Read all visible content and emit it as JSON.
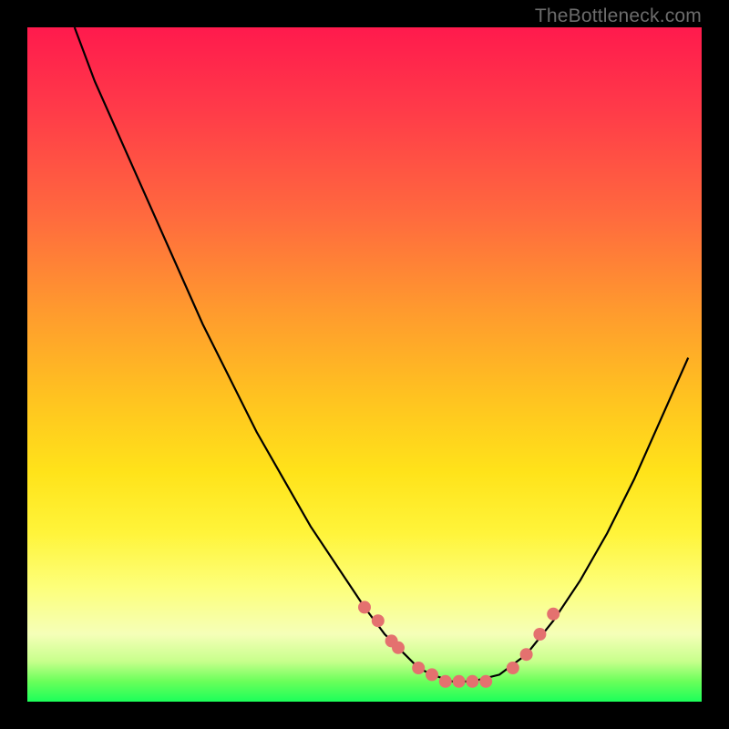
{
  "watermark": "TheBottleneck.com",
  "chart_data": {
    "type": "line",
    "title": "",
    "xlabel": "",
    "ylabel": "",
    "xlim": [
      0,
      100
    ],
    "ylim": [
      0,
      100
    ],
    "grid": false,
    "legend": false,
    "series": [
      {
        "name": "bottleneck-curve",
        "color": "#000000",
        "x": [
          7,
          10,
          14,
          18,
          22,
          26,
          30,
          34,
          38,
          42,
          46,
          50,
          53,
          56,
          58,
          60,
          63,
          66,
          70,
          74,
          78,
          82,
          86,
          90,
          94,
          98
        ],
        "y": [
          100,
          92,
          83,
          74,
          65,
          56,
          48,
          40,
          33,
          26,
          20,
          14,
          10,
          7,
          5,
          4,
          3,
          3,
          4,
          7,
          12,
          18,
          25,
          33,
          42,
          51
        ]
      },
      {
        "name": "highlight-points",
        "color": "#e4716f",
        "type": "scatter",
        "x": [
          50,
          52,
          54,
          55,
          58,
          60,
          62,
          64,
          66,
          68,
          72,
          74,
          76,
          78
        ],
        "y": [
          14,
          12,
          9,
          8,
          5,
          4,
          3,
          3,
          3,
          3,
          5,
          7,
          10,
          13
        ]
      }
    ]
  }
}
